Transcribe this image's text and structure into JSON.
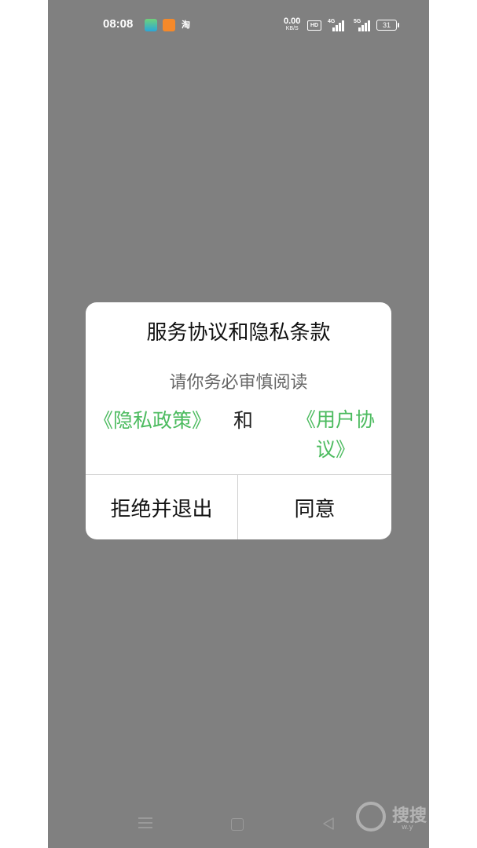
{
  "status_bar": {
    "time": "08:08",
    "app_icon_3": "淘",
    "net_speed_value": "0.00",
    "net_speed_unit": "KB/S",
    "hd_badge": "HD",
    "signal_1_label": "4G",
    "signal_2_label": "5G",
    "battery": "31"
  },
  "dialog": {
    "title": "服务协议和隐私条款",
    "subtitle": "请你务必审慎阅读",
    "privacy_link": "《隐私政策》",
    "and_text": "和",
    "user_agreement_link": "《用户协议》",
    "reject_button": "拒绝并退出",
    "agree_button": "同意"
  },
  "watermark": {
    "text": "搜搜",
    "small": "w.y"
  },
  "colors": {
    "overlay": "#808080",
    "link_green": "#4cbb5f",
    "dialog_bg": "#ffffff"
  }
}
